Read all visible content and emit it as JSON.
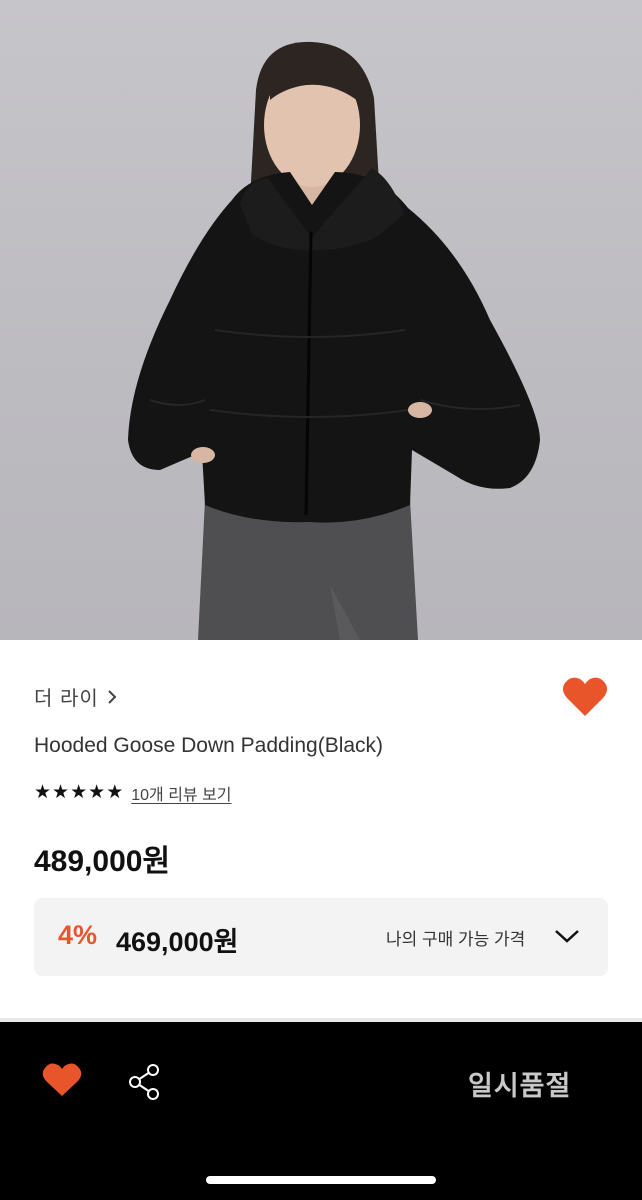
{
  "product": {
    "image_alt": "model wearing black hooded down jacket",
    "brand": "더 라이",
    "title": "Hooded Goose Down Padding(Black)",
    "rating_stars": 5,
    "review_link": "10개 리뷰 보기",
    "price": "489,000원"
  },
  "deal": {
    "discount": "4%",
    "price": "469,000원",
    "label": "나의 구매 가능 가격"
  },
  "bottom_bar": {
    "sold_out": "일시품절"
  },
  "colors": {
    "accent": "#E8552A",
    "bottom_bar": "#000000",
    "deal_bg": "#F3F3F3"
  },
  "icons": [
    "chevron-right-icon",
    "heart-icon",
    "star-icon",
    "chevron-down-icon",
    "share-icon"
  ]
}
